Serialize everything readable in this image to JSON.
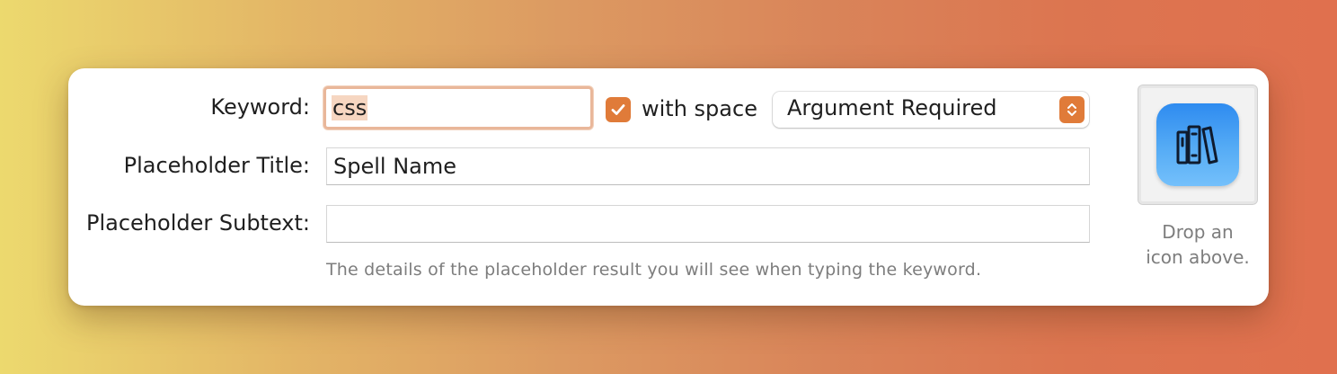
{
  "form": {
    "keyword_label": "Keyword:",
    "keyword_value": "css",
    "with_space_label": "with space",
    "with_space_checked": true,
    "argument_select": "Argument Required",
    "placeholder_title_label": "Placeholder Title:",
    "placeholder_title_value": "Spell Name",
    "placeholder_subtext_label": "Placeholder Subtext:",
    "placeholder_subtext_value": "",
    "help_text": "The details of the placeholder result you will see when typing the keyword."
  },
  "icon_well": {
    "icon": "books-icon",
    "drop_line1": "Drop an",
    "drop_line2": "icon above."
  },
  "colors": {
    "accent": "#e07b39",
    "focus_ring": "#e9b79a",
    "icon_blue": "#3a96f2"
  }
}
